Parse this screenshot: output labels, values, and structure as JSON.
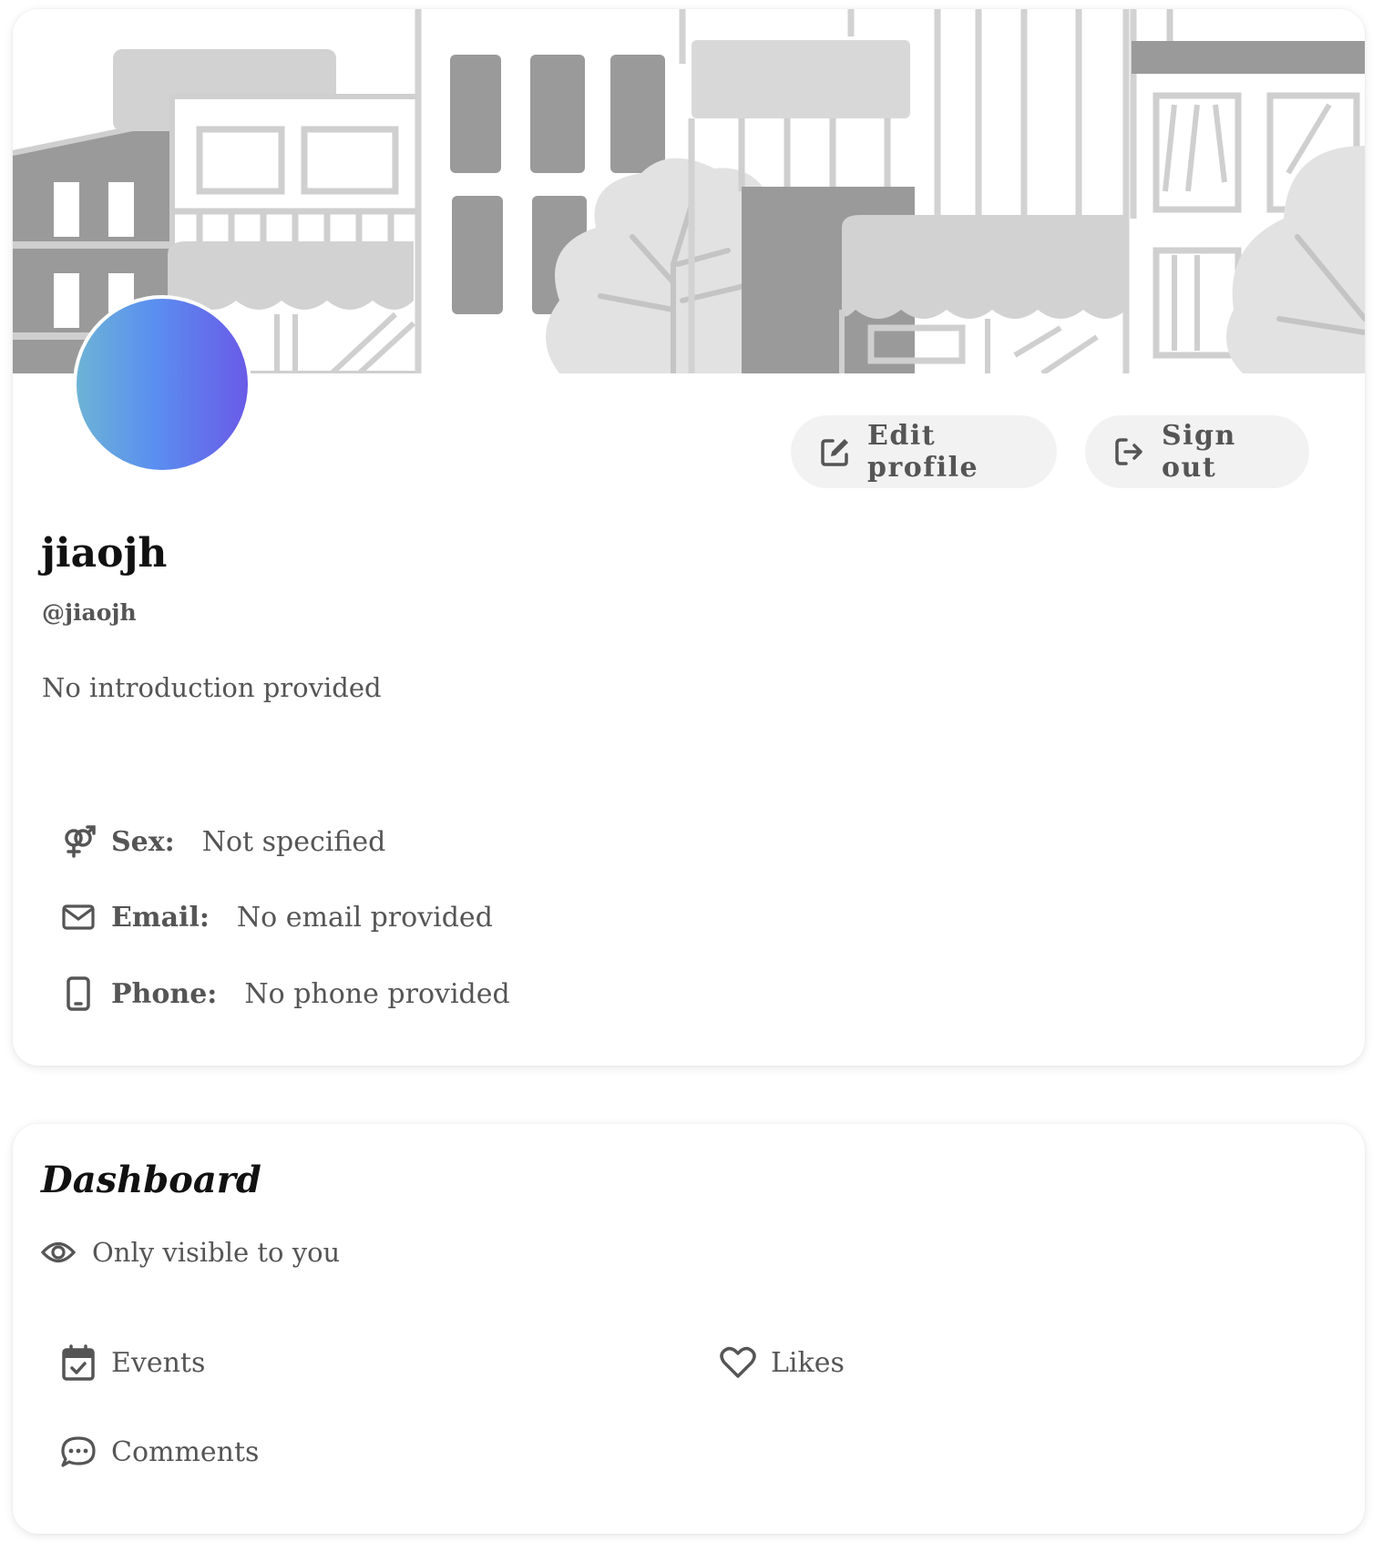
{
  "profile": {
    "display_name": "jiaojh",
    "handle": "@jiaojh",
    "introduction": "No introduction provided",
    "avatar_gradient": [
      "#6db3d6",
      "#5a8ff0",
      "#6a5ae8"
    ]
  },
  "actions": {
    "edit_label": "Edit profile",
    "signout_label": "Sign out"
  },
  "info": {
    "sex_label": "Sex:",
    "sex_value": "Not specified",
    "email_label": "Email:",
    "email_value": "No email provided",
    "phone_label": "Phone:",
    "phone_value": "No phone provided"
  },
  "dashboard": {
    "title": "Dashboard",
    "visibility": "Only visible to you",
    "items": {
      "events": "Events",
      "likes": "Likes",
      "comments": "Comments"
    }
  },
  "icons": [
    "pen-to-square-icon",
    "sign-out-icon",
    "gender-icon",
    "envelope-icon",
    "mobile-phone-icon",
    "eye-icon",
    "calendar-check-icon",
    "heart-icon",
    "comment-dots-icon"
  ]
}
